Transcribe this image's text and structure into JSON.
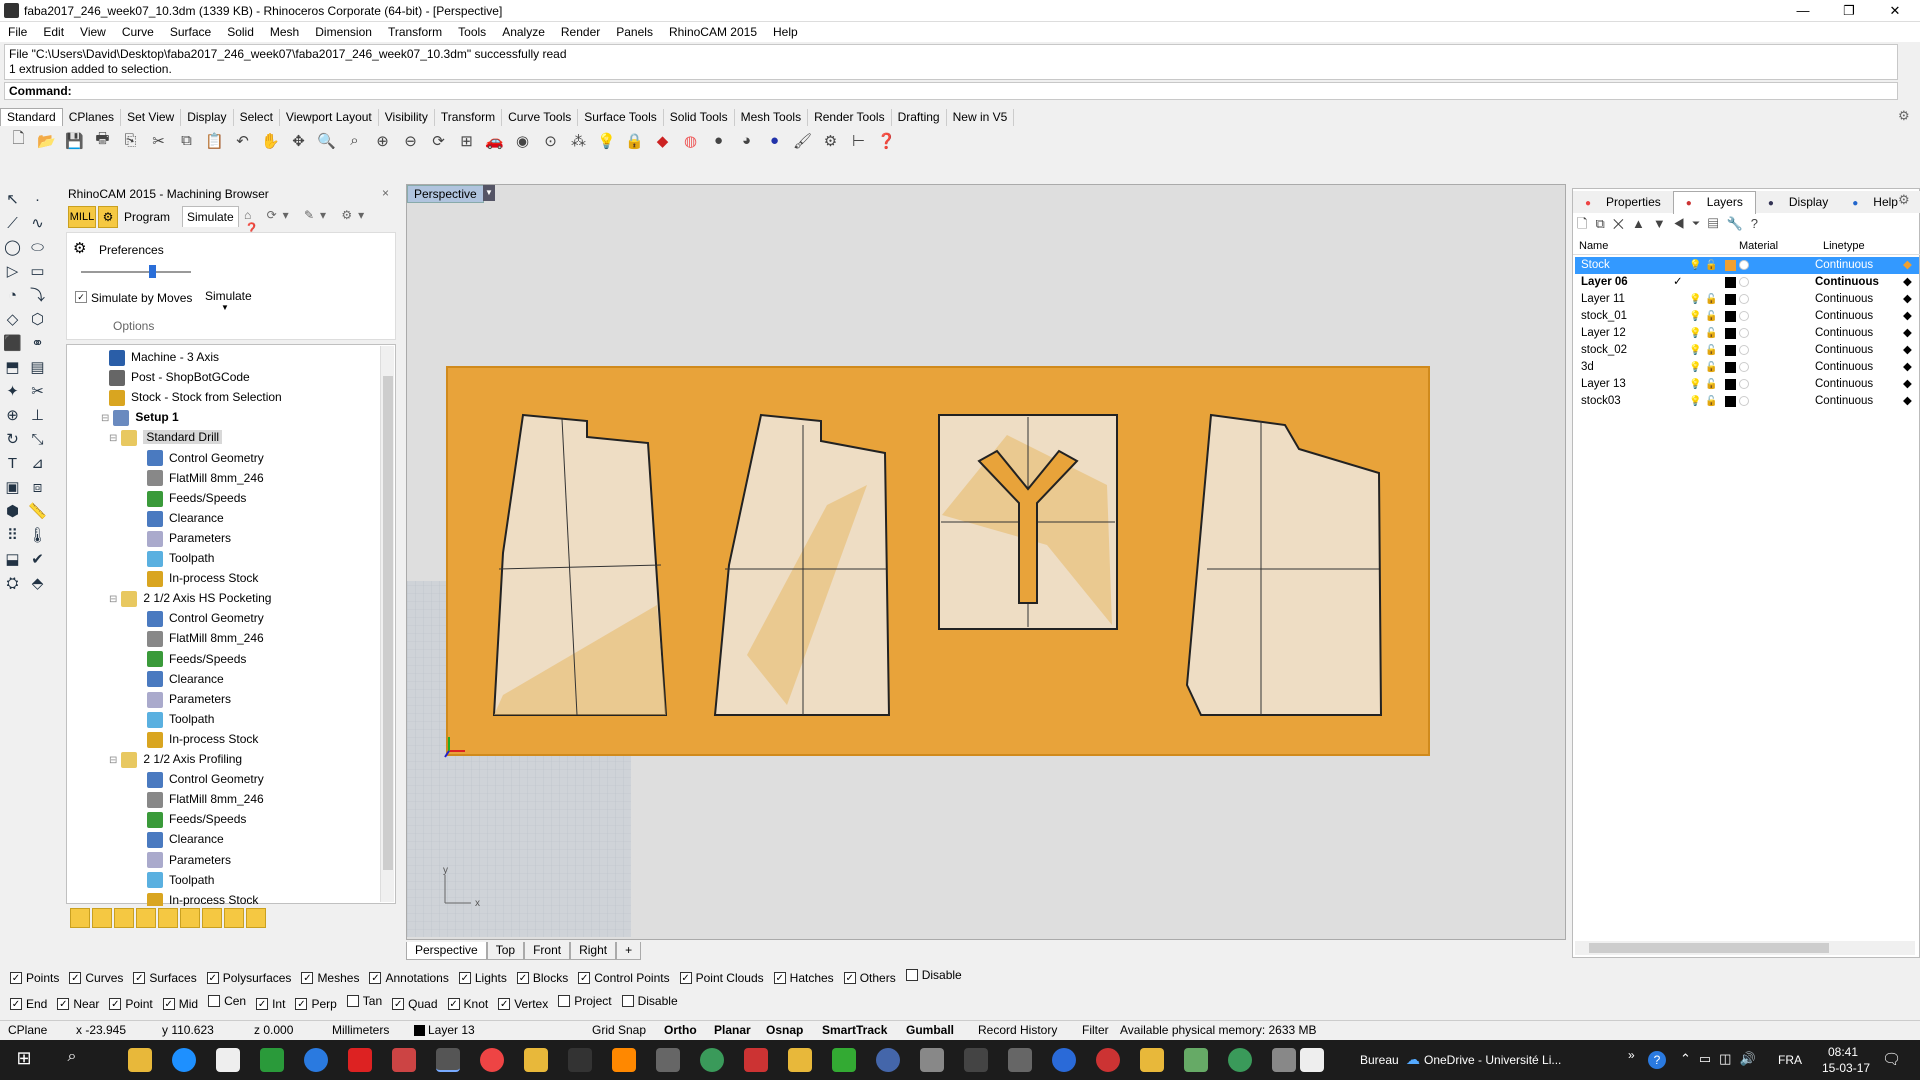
{
  "titlebar": {
    "title": "faba2017_246_week07_10.3dm (1339 KB) - Rhinoceros Corporate (64-bit) - [Perspective]",
    "minimize": "—",
    "restore": "❐",
    "close": "✕"
  },
  "menu": [
    "File",
    "Edit",
    "View",
    "Curve",
    "Surface",
    "Solid",
    "Mesh",
    "Dimension",
    "Transform",
    "Tools",
    "Analyze",
    "Render",
    "Panels",
    "RhinoCAM 2015",
    "Help"
  ],
  "command": {
    "history_line1": "File \"C:\\Users\\David\\Desktop\\faba2017_246_week07\\faba2017_246_week07_10.3dm\" successfully read",
    "history_line2": "1 extrusion added to selection.",
    "prompt": "Command:"
  },
  "toolbar_tabs": [
    "Standard",
    "CPlanes",
    "Set View",
    "Display",
    "Select",
    "Viewport Layout",
    "Visibility",
    "Transform",
    "Curve Tools",
    "Surface Tools",
    "Solid Tools",
    "Mesh Tools",
    "Render Tools",
    "Drafting",
    "New in V5"
  ],
  "browser": {
    "title": "RhinoCAM 2015 - Machining Browser",
    "tab_mill": "MILL",
    "tab_program": "Program",
    "tab_simulate": "Simulate",
    "preferences": "Preferences",
    "simulate_by_moves": "Simulate by Moves",
    "simulate": "Simulate",
    "options": "Options",
    "tree": [
      {
        "label": "Machine - 3 Axis",
        "level": 2,
        "bold": false,
        "color": "#2a5ea8"
      },
      {
        "label": "Post - ShopBotGCode",
        "level": 2,
        "bold": false,
        "color": "#666"
      },
      {
        "label": "Stock - Stock from Selection",
        "level": 2,
        "bold": false,
        "color": "#d9a520"
      },
      {
        "label": "Setup 1",
        "level": 1,
        "bold": true,
        "color": "#6a8abf"
      },
      {
        "label": "Standard Drill",
        "level": 2,
        "bold": false,
        "color": "#e8c860",
        "highlight": true
      },
      {
        "label": "Control Geometry",
        "level": 3,
        "bold": false,
        "color": "#4a7ac0"
      },
      {
        "label": "FlatMill 8mm_246",
        "level": 3,
        "bold": false,
        "color": "#888"
      },
      {
        "label": "Feeds/Speeds",
        "level": 3,
        "bold": false,
        "color": "#3a9a3a"
      },
      {
        "label": "Clearance",
        "level": 3,
        "bold": false,
        "color": "#4a7ac0"
      },
      {
        "label": "Parameters",
        "level": 3,
        "bold": false,
        "color": "#aac"
      },
      {
        "label": "Toolpath",
        "level": 3,
        "bold": false,
        "color": "#5ab0e0"
      },
      {
        "label": "In-process Stock",
        "level": 3,
        "bold": false,
        "color": "#d9a520"
      },
      {
        "label": "2 1/2 Axis HS Pocketing",
        "level": 2,
        "bold": false,
        "color": "#e8c860"
      },
      {
        "label": "Control Geometry",
        "level": 3,
        "bold": false,
        "color": "#4a7ac0"
      },
      {
        "label": "FlatMill 8mm_246",
        "level": 3,
        "bold": false,
        "color": "#888"
      },
      {
        "label": "Feeds/Speeds",
        "level": 3,
        "bold": false,
        "color": "#3a9a3a"
      },
      {
        "label": "Clearance",
        "level": 3,
        "bold": false,
        "color": "#4a7ac0"
      },
      {
        "label": "Parameters",
        "level": 3,
        "bold": false,
        "color": "#aac"
      },
      {
        "label": "Toolpath",
        "level": 3,
        "bold": false,
        "color": "#5ab0e0"
      },
      {
        "label": "In-process Stock",
        "level": 3,
        "bold": false,
        "color": "#d9a520"
      },
      {
        "label": "2 1/2 Axis Profiling",
        "level": 2,
        "bold": false,
        "color": "#e8c860"
      },
      {
        "label": "Control Geometry",
        "level": 3,
        "bold": false,
        "color": "#4a7ac0"
      },
      {
        "label": "FlatMill 8mm_246",
        "level": 3,
        "bold": false,
        "color": "#888"
      },
      {
        "label": "Feeds/Speeds",
        "level": 3,
        "bold": false,
        "color": "#3a9a3a"
      },
      {
        "label": "Clearance",
        "level": 3,
        "bold": false,
        "color": "#4a7ac0"
      },
      {
        "label": "Parameters",
        "level": 3,
        "bold": false,
        "color": "#aac"
      },
      {
        "label": "Toolpath",
        "level": 3,
        "bold": false,
        "color": "#5ab0e0"
      },
      {
        "label": "In-process Stock",
        "level": 3,
        "bold": false,
        "color": "#d9a520"
      }
    ]
  },
  "viewport": {
    "label": "Perspective",
    "stock_color": "#e8a33a",
    "axis_y": "y",
    "axis_x": "x"
  },
  "view_tabs": [
    "Perspective",
    "Top",
    "Front",
    "Right",
    "+"
  ],
  "right_panel": {
    "tabs": [
      "Properties",
      "Layers",
      "Display",
      "Help"
    ],
    "columns": {
      "name": "Name",
      "material": "Material",
      "linetype": "Linetype"
    },
    "layers": [
      {
        "name": "Stock",
        "linetype": "Continuous",
        "color": "#f0a030",
        "selected": true,
        "current": false
      },
      {
        "name": "Layer 06",
        "linetype": "Continuous",
        "color": "#000000",
        "selected": false,
        "current": true
      },
      {
        "name": "Layer 11",
        "linetype": "Continuous",
        "color": "#000000",
        "selected": false,
        "current": false
      },
      {
        "name": "stock_01",
        "linetype": "Continuous",
        "color": "#000000",
        "selected": false,
        "current": false
      },
      {
        "name": "Layer 12",
        "linetype": "Continuous",
        "color": "#000000",
        "selected": false,
        "current": false
      },
      {
        "name": "stock_02",
        "linetype": "Continuous",
        "color": "#000000",
        "selected": false,
        "current": false
      },
      {
        "name": "3d",
        "linetype": "Continuous",
        "color": "#000000",
        "selected": false,
        "current": false
      },
      {
        "name": "Layer 13",
        "linetype": "Continuous",
        "color": "#000000",
        "selected": false,
        "current": false
      },
      {
        "name": "stock03",
        "linetype": "Continuous",
        "color": "#000000",
        "selected": false,
        "current": false
      }
    ]
  },
  "filters": [
    {
      "label": "Points",
      "checked": true
    },
    {
      "label": "Curves",
      "checked": true
    },
    {
      "label": "Surfaces",
      "checked": true
    },
    {
      "label": "Polysurfaces",
      "checked": true
    },
    {
      "label": "Meshes",
      "checked": true
    },
    {
      "label": "Annotations",
      "checked": true
    },
    {
      "label": "Lights",
      "checked": true
    },
    {
      "label": "Blocks",
      "checked": true
    },
    {
      "label": "Control Points",
      "checked": true
    },
    {
      "label": "Point Clouds",
      "checked": true
    },
    {
      "label": "Hatches",
      "checked": true
    },
    {
      "label": "Others",
      "checked": true
    },
    {
      "label": "Disable",
      "checked": false
    }
  ],
  "osnaps": [
    {
      "label": "End",
      "checked": true
    },
    {
      "label": "Near",
      "checked": true
    },
    {
      "label": "Point",
      "checked": true
    },
    {
      "label": "Mid",
      "checked": true
    },
    {
      "label": "Cen",
      "checked": false
    },
    {
      "label": "Int",
      "checked": true
    },
    {
      "label": "Perp",
      "checked": true
    },
    {
      "label": "Tan",
      "checked": false
    },
    {
      "label": "Quad",
      "checked": true
    },
    {
      "label": "Knot",
      "checked": true
    },
    {
      "label": "Vertex",
      "checked": true
    },
    {
      "label": "Project",
      "checked": false
    },
    {
      "label": "Disable",
      "checked": false
    }
  ],
  "status": {
    "cplane": "CPlane",
    "x": "x -23.945",
    "y": "y 110.623",
    "z": "z 0.000",
    "units": "Millimeters",
    "layer": "Layer 13",
    "grid_snap": "Grid Snap",
    "ortho": "Ortho",
    "planar": "Planar",
    "osnap": "Osnap",
    "smarttrack": "SmartTrack",
    "gumball": "Gumball",
    "record_history": "Record History",
    "filter": "Filter",
    "memory": "Available physical memory: 2633 MB"
  },
  "taskbar": {
    "bureau": "Bureau",
    "onedrive": "OneDrive - Université Li...",
    "lang": "FRA",
    "time": "08:41",
    "date": "15-03-17"
  }
}
